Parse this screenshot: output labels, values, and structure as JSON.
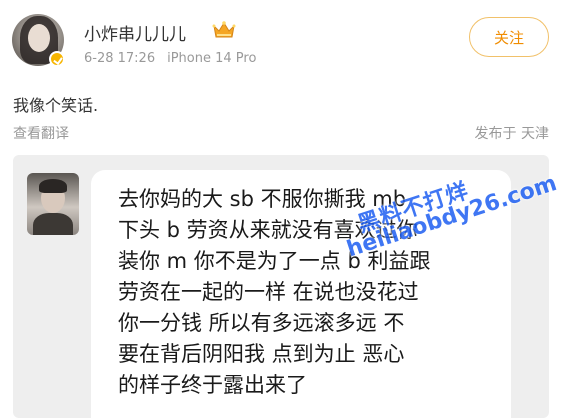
{
  "post": {
    "username": "小炸串儿儿儿",
    "date": "6-28 17:26",
    "device": "iPhone 14 Pro",
    "follow_label": "关注",
    "text": "我像个笑话.",
    "translate_label": "查看翻译",
    "location": "发布于 天津"
  },
  "embedded_message": {
    "lines": [
      "去你妈的大 sb 不服你撕我 mb",
      "下头 b 劳资从来就没有喜欢过你",
      "装你 m 你不是为了一点 b 利益跟",
      "劳资在一起的一样 在说也没花过",
      "你一分钱  所以有多远滚多远 不",
      "要在背后阴阳我 点到为止 恶心",
      "的样子终于露出来了"
    ]
  },
  "watermark": {
    "line1": "黑料不打烊",
    "line2": "heiliaobdy26.com",
    "color": "#1e5ff2"
  },
  "colors": {
    "accent_orange": "#f08c00",
    "badge_yellow": "#f7b500",
    "meta_gray": "#999999"
  }
}
